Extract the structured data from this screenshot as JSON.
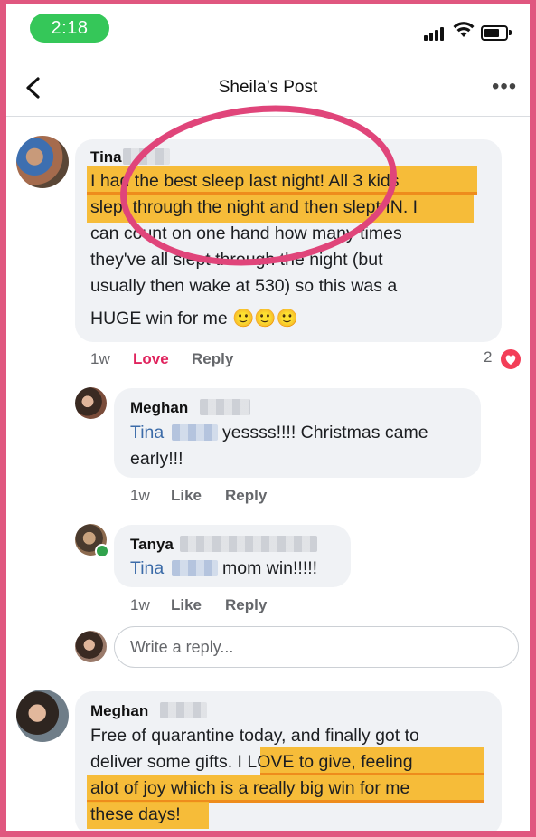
{
  "status_bar": {
    "time": "2:18"
  },
  "nav": {
    "title": "Sheila’s Post"
  },
  "comments": [
    {
      "author": "Tina",
      "lines": [
        "I had the best sleep last night! All 3 kids",
        "slept through the night and then slept IN. I",
        "can count on one hand how many times",
        "they've all slept through the night (but",
        "usually then wake at 530) so this was a",
        "HUGE win for me 🙂🙂🙂"
      ],
      "time": "1w",
      "reaction_label": "Love",
      "reply_label": "Reply",
      "reaction_count": "2"
    },
    {
      "author": "Meghan",
      "mention": "Tina",
      "lines": [
        "yessss!!!! Christmas came",
        "early!!!"
      ],
      "time": "1w",
      "like_label": "Like",
      "reply_label": "Reply"
    },
    {
      "author": "Tanya",
      "mention": "Tina",
      "lines": [
        "mom win!!!!!"
      ],
      "time": "1w",
      "like_label": "Like",
      "reply_label": "Reply"
    },
    {
      "author": "Meghan",
      "lines": [
        "Free of quarantine today, and finally got to",
        "deliver some gifts. I LOVE to give, feeling",
        "alot of joy which is a really big win for me",
        "these days!"
      ]
    }
  ],
  "reply_box": {
    "placeholder": "Write a reply..."
  },
  "colors": {
    "frame": "#e0577f",
    "highlight": "#f5b82e",
    "annotation_circle": "#e0457a",
    "heart": "#f33e58",
    "online": "#31a24c"
  },
  "icons": [
    "back-icon",
    "more-icon",
    "signal-icon",
    "wifi-icon",
    "battery-icon",
    "heart-icon"
  ]
}
